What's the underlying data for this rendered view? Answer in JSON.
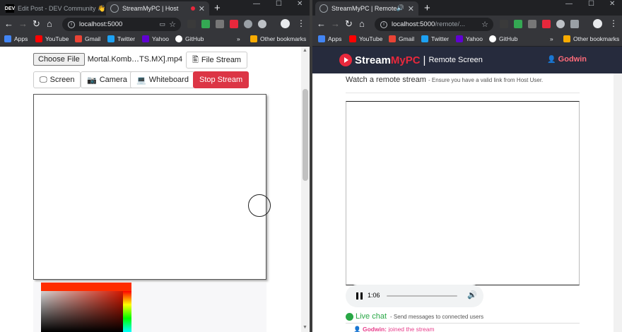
{
  "left": {
    "tabs": [
      {
        "favicon": "DEV",
        "title": "Edit Post - DEV Community 👋",
        "active": false
      },
      {
        "favicon": "globe-icon",
        "title": "StreamMyPC | Host",
        "active": true
      }
    ],
    "url": "localhost:5000",
    "url_path": "",
    "bookmarks": [
      "Apps",
      "YouTube",
      "Gmail",
      "Twitter",
      "Yahoo",
      "GitHub"
    ],
    "other_bookmarks": "Other bookmarks",
    "page": {
      "choose_file_label": "Choose File",
      "file_name": "Mortal.Komb…TS.MX].mp4",
      "file_stream_label": "File Stream",
      "screen_label": "Screen",
      "camera_label": "Camera",
      "whiteboard_label": "Whiteboard",
      "stop_stream_label": "Stop Stream",
      "stop_color": "#dc3545"
    }
  },
  "right": {
    "tabs": [
      {
        "favicon": "globe-icon",
        "title": "StreamMyPC | Remote",
        "active": true
      }
    ],
    "url": "localhost:5000",
    "url_path": "/remote/...",
    "bookmarks": [
      "Apps",
      "YouTube",
      "Gmail",
      "Twitter",
      "Yahoo",
      "GitHub"
    ],
    "other_bookmarks": "Other bookmarks",
    "page": {
      "brand_a": "Stream",
      "brand_b": "MyPC",
      "brand_sep": "|",
      "brand_sub": "Remote Screen",
      "user_name": "Godwin",
      "watch_title": "Watch a remote stream",
      "watch_hint": "- Ensure you have a valid link from Host User.",
      "player_time": "1:06",
      "player_progress": 0.0,
      "live_chat_title": "Live chat",
      "live_chat_hint": "- Send messages to connected users",
      "chat_messages": [
        {
          "user": "Godwin:",
          "text": "joined the stream"
        }
      ],
      "accent_color": "#e8283c",
      "live_color": "#28a745"
    }
  }
}
